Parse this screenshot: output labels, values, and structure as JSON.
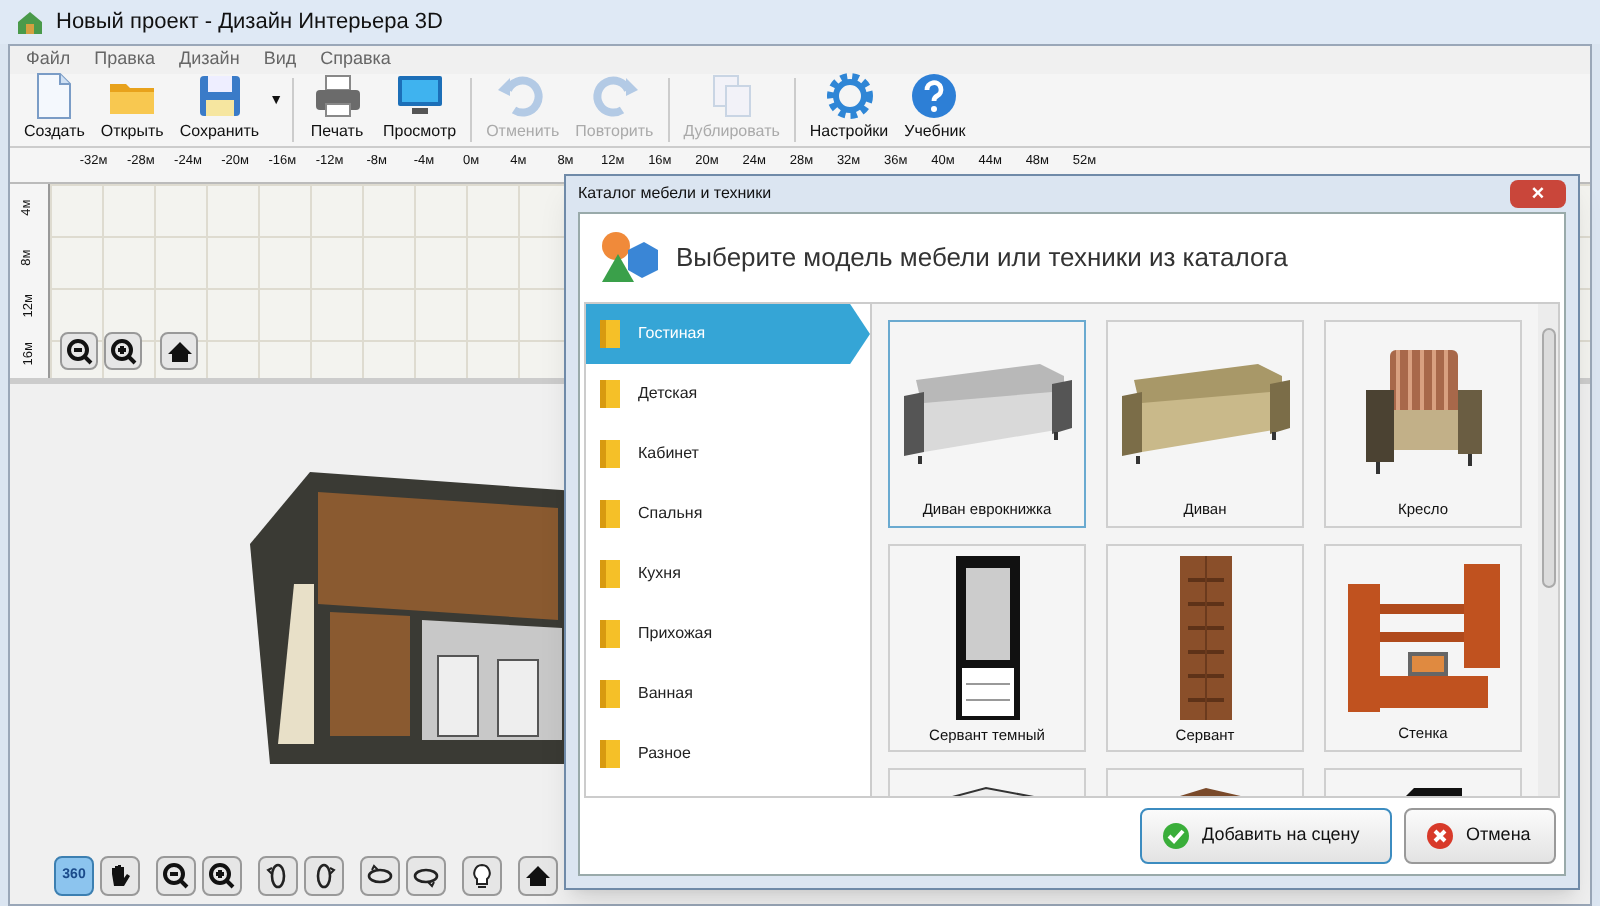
{
  "window": {
    "title": "Новый проект - Дизайн Интерьера 3D"
  },
  "menu": [
    "Файл",
    "Правка",
    "Дизайн",
    "Вид",
    "Справка"
  ],
  "toolbar": [
    {
      "kind": "new",
      "label": "Создать",
      "disabled": false
    },
    {
      "kind": "open",
      "label": "Открыть",
      "disabled": false
    },
    {
      "kind": "save",
      "label": "Сохранить",
      "disabled": false,
      "dropdown": "▼"
    },
    {
      "kind": "print",
      "label": "Печать",
      "disabled": false
    },
    {
      "kind": "preview",
      "label": "Просмотр",
      "disabled": false
    },
    {
      "kind": "undo",
      "label": "Отменить",
      "disabled": true
    },
    {
      "kind": "redo",
      "label": "Повторить",
      "disabled": true
    },
    {
      "kind": "duplicate",
      "label": "Дублировать",
      "disabled": true
    },
    {
      "kind": "settings",
      "label": "Настройки",
      "disabled": false
    },
    {
      "kind": "help",
      "label": "Учебник",
      "disabled": false
    }
  ],
  "ruler_top": [
    "-32м",
    "-28м",
    "-24м",
    "-20м",
    "-16м",
    "-12м",
    "-8м",
    "-4м",
    "0м",
    "4м",
    "8м",
    "12м",
    "16м",
    "20м",
    "24м",
    "28м",
    "32м",
    "36м",
    "40м",
    "44м",
    "48м",
    "52м"
  ],
  "ruler_left": [
    "4м",
    "8м",
    "12м",
    "16м"
  ],
  "plan_buttons": [
    {
      "kind": "zoom-out"
    },
    {
      "kind": "zoom-in"
    },
    {
      "kind": "home"
    }
  ],
  "view_buttons": [
    {
      "kind": "rotate",
      "label": "360",
      "selected": true
    },
    {
      "kind": "pan",
      "selected": false
    },
    {
      "kind": "zoom-out",
      "selected": false
    },
    {
      "kind": "zoom-in",
      "selected": false
    },
    {
      "kind": "turn-left",
      "selected": false
    },
    {
      "kind": "turn-right",
      "selected": false
    },
    {
      "kind": "tilt-up",
      "selected": false
    },
    {
      "kind": "tilt-down",
      "selected": false
    },
    {
      "kind": "light",
      "selected": false
    },
    {
      "kind": "home",
      "selected": false
    }
  ],
  "dialog": {
    "title": "Каталог мебели и техники",
    "close": "×",
    "heading": "Выберите модель мебели или техники из каталога",
    "categories": [
      {
        "label": "Гостиная",
        "selected": true
      },
      {
        "label": "Детская",
        "selected": false
      },
      {
        "label": "Кабинет",
        "selected": false
      },
      {
        "label": "Спальня",
        "selected": false
      },
      {
        "label": "Кухня",
        "selected": false
      },
      {
        "label": "Прихожая",
        "selected": false
      },
      {
        "label": "Ванная",
        "selected": false
      },
      {
        "label": "Разное",
        "selected": false
      }
    ],
    "items": [
      {
        "kind": "sofa-grey",
        "label": "Диван еврокнижка",
        "selected": true
      },
      {
        "kind": "sofa-beige",
        "label": "Диван",
        "selected": false
      },
      {
        "kind": "armchair",
        "label": "Кресло",
        "selected": false
      },
      {
        "kind": "cabinet-dark",
        "label": "Сервант темный",
        "selected": false
      },
      {
        "kind": "cabinet-wood",
        "label": "Сервант",
        "selected": false
      },
      {
        "kind": "wall-unit",
        "label": "Стенка",
        "selected": false
      },
      {
        "kind": "partial-white",
        "selected": false
      },
      {
        "kind": "partial-wood",
        "selected": false
      },
      {
        "kind": "partial-dark",
        "selected": false
      }
    ],
    "buttons": [
      {
        "kind": "ok",
        "label": "Добавить на сцену"
      },
      {
        "kind": "cancel",
        "label": "Отмена"
      }
    ]
  }
}
